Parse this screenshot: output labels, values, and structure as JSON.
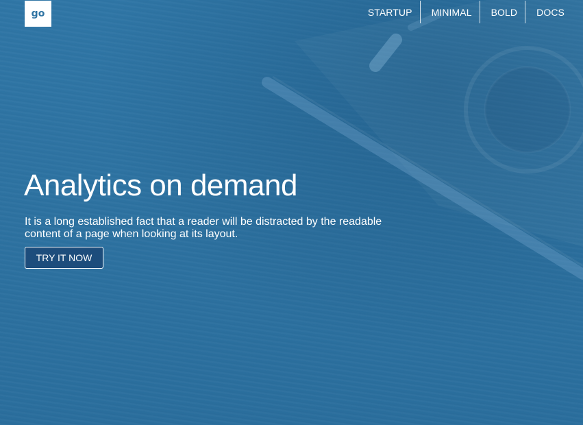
{
  "logo": {
    "text": "go"
  },
  "nav": {
    "items": [
      {
        "label": "STARTUP"
      },
      {
        "label": "MINIMAL"
      },
      {
        "label": "BOLD"
      },
      {
        "label": "DOCS"
      }
    ]
  },
  "hero": {
    "headline": "Analytics on demand",
    "lead": "It is a long established fact that a reader will be distracted by the readable content of a page when looking at its layout.",
    "cta_label": "TRY IT NOW"
  },
  "colors": {
    "background": "#2e73a2",
    "button": "#1d4d7c",
    "text": "#ffffff"
  },
  "background_image": {
    "icon": "camera-on-desk-photo"
  }
}
